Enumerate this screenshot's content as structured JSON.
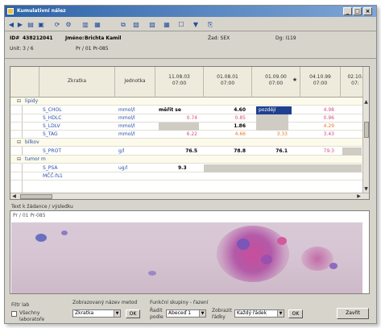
{
  "window": {
    "title": "Kumulativní nález"
  },
  "toolbar": {
    "icons": [
      "back-icon",
      "forward-icon",
      "print-icon",
      "save-icon",
      "refresh-icon",
      "settings-icon",
      "chart-icon",
      "filter-icon",
      "copy-icon",
      "paste-icon",
      "book-icon",
      "grid-icon",
      "layout-icon",
      "funnel-icon",
      "export-icon"
    ]
  },
  "patient": {
    "id_label": "ID#",
    "id_value": "438212041",
    "name_label": "Jméno:",
    "name_value": "Brichta Kamil",
    "zad_label": "Žad: SEX",
    "dg_label": "Dg: I119",
    "unit_label": "Unit: 3 / 6",
    "pr_label": "Pr / 01 Pr-085"
  },
  "grid": {
    "col_headers": {
      "zkratka": "Zkratka",
      "jednotka": "Jednotka"
    },
    "dates": [
      {
        "date": "11.08.03",
        "time": "07:00"
      },
      {
        "date": "01.08.01",
        "time": "07:00"
      },
      {
        "date": "01.09.00",
        "time": "07:00"
      },
      {
        "date": "04.10.99",
        "time": "07:00"
      },
      {
        "date": "02.10.",
        "time": "07:"
      }
    ],
    "rows": [
      {
        "kind": "group",
        "name": "lipidy"
      },
      {
        "kind": "data",
        "name": "S_CHOL",
        "unit": "mmol/l",
        "v": [
          "měřit se",
          "4.60",
          "pozdějí",
          "4.98",
          ""
        ]
      },
      {
        "kind": "data",
        "name": "S_HDLC",
        "unit": "mmol/l",
        "v": [
          "0.74",
          "0.85",
          "",
          "0.96",
          ""
        ]
      },
      {
        "kind": "data",
        "name": "S_LDLV",
        "unit": "mmol/l",
        "v": [
          "",
          "1.86",
          "",
          "4.29",
          ""
        ]
      },
      {
        "kind": "data",
        "name": "S_TAG",
        "unit": "mmol/l",
        "v": [
          "6.22",
          "4.66",
          "3.33",
          "3.43",
          ""
        ]
      },
      {
        "kind": "group",
        "name": "bílkov"
      },
      {
        "kind": "data",
        "name": "S_PROT",
        "unit": "g/l",
        "v": [
          "76.5",
          "78.8",
          "76.1",
          "79.3",
          ""
        ]
      },
      {
        "kind": "group",
        "name": "tumor m"
      },
      {
        "kind": "data",
        "name": "S_PSA",
        "unit": "ug/l",
        "v": [
          "9.3",
          "",
          "",
          "",
          ""
        ]
      },
      {
        "kind": "data",
        "name": "MČČ-fs1",
        "unit": "",
        "v": [
          "",
          "",
          "",
          "",
          ""
        ]
      }
    ]
  },
  "text_section": {
    "label": "Text k žádance / výsledku",
    "text": "Pr / 01 Pr-085"
  },
  "bottom": {
    "filter_label": "Filtr lab",
    "checkbox_label_1": "Všechny",
    "checkbox_label_2": "laboratoře",
    "method_label": "Zobrazovaný název metod",
    "method_value": "Zkratka",
    "ok1": "OK",
    "groups_label": "Funkční skupiny - řazení",
    "sort_label_1": "Řadit",
    "sort_label_2": "podle",
    "sort_value": "Abeceď 1",
    "show_label_1": "Zobrazit",
    "show_label_2": "řádky",
    "show_value": "Každý řádek",
    "ok2": "OK",
    "close": "Zavřít"
  },
  "colors": {
    "title_start": "#2d63a8",
    "title_end": "#7ea5d6",
    "value_pink": "#d24a8a",
    "value_orange": "#e07a2a",
    "label_blue": "#2a4fa8",
    "selection": "#1f3f8f"
  }
}
